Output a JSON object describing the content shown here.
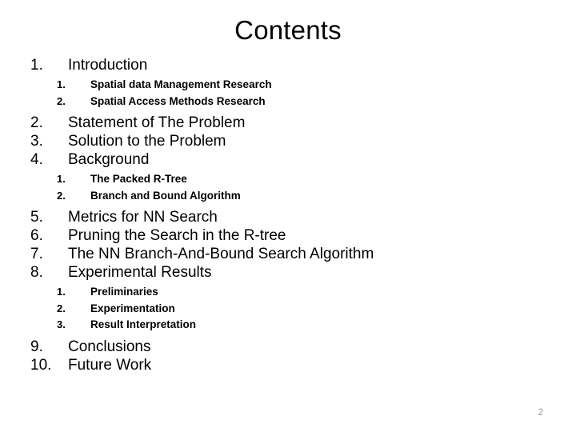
{
  "slide": {
    "title": "Contents",
    "page_number": "2",
    "background_color": "#ffffff",
    "text_color": "#000000",
    "page_number_color": "#9a9a9a"
  },
  "toc": {
    "entries": [
      {
        "number": "1.",
        "label": "Introduction",
        "level": 1,
        "children": [
          {
            "number": "1.",
            "label": "Spatial data Management Research",
            "level": 2
          },
          {
            "number": "2.",
            "label": "Spatial Access Methods Research",
            "level": 2
          }
        ]
      },
      {
        "number": "2.",
        "label": "Statement of The Problem",
        "level": 1,
        "children": []
      },
      {
        "number": "3.",
        "label": "Solution to the Problem",
        "level": 1,
        "children": []
      },
      {
        "number": "4.",
        "label": "Background",
        "level": 1,
        "children": [
          {
            "number": "1.",
            "label": "The Packed R-Tree",
            "level": 2
          },
          {
            "number": "2.",
            "label": "Branch and Bound Algorithm",
            "level": 2
          }
        ]
      },
      {
        "number": "5.",
        "label": "Metrics for NN Search",
        "level": 1,
        "children": []
      },
      {
        "number": "6.",
        "label": "Pruning the Search in the R-tree",
        "level": 1,
        "children": []
      },
      {
        "number": "7.",
        "label": "The NN Branch-And-Bound Search Algorithm",
        "level": 1,
        "children": []
      },
      {
        "number": "8.",
        "label": "Experimental Results",
        "level": 1,
        "children": [
          {
            "number": "1.",
            "label": "Preliminaries",
            "level": 2
          },
          {
            "number": "2.",
            "label": "Experimentation",
            "level": 2
          },
          {
            "number": "3.",
            "label": "Result Interpretation",
            "level": 2
          }
        ]
      },
      {
        "number": "9.",
        "label": "Conclusions",
        "level": 1,
        "children": []
      },
      {
        "number": "10.",
        "label": "Future Work",
        "level": 1,
        "children": []
      }
    ]
  }
}
